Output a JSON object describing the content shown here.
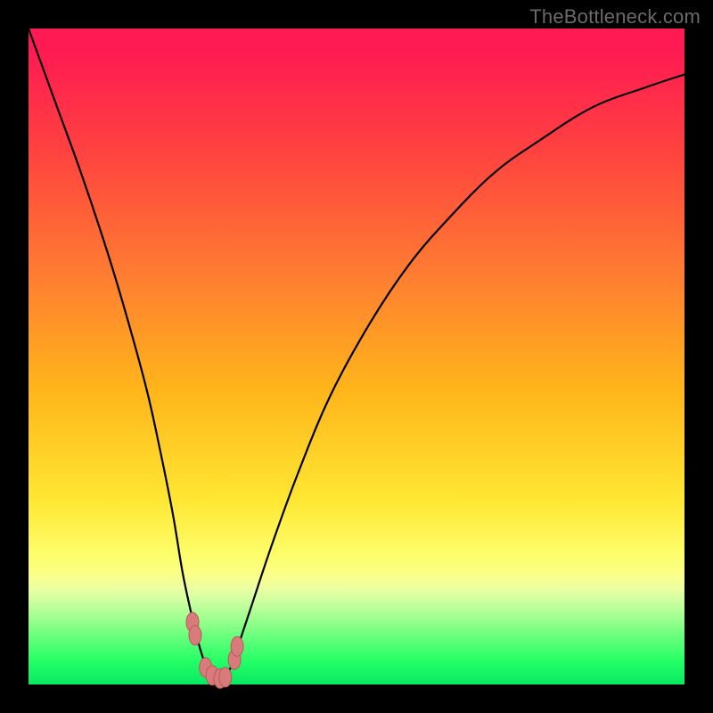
{
  "watermark": "TheBottleneck.com",
  "chart_data": {
    "type": "line",
    "title": "",
    "xlabel": "",
    "ylabel": "",
    "xlim": [
      0,
      100
    ],
    "ylim": [
      0,
      100
    ],
    "series": [
      {
        "name": "bottleneck-curve",
        "x": [
          0,
          4,
          8,
          12,
          15,
          18,
          20,
          22,
          23.5,
          25,
          26,
          27,
          28,
          29,
          30,
          31,
          32,
          34,
          37,
          41,
          46,
          52,
          58,
          64,
          71,
          78,
          86,
          94,
          100
        ],
        "values": [
          100,
          89,
          78,
          66,
          56,
          45,
          36,
          26,
          17,
          10,
          6,
          3,
          1.5,
          0.7,
          1.2,
          3,
          6,
          12,
          21,
          32,
          44,
          55,
          64,
          71,
          78,
          83,
          88,
          91,
          93
        ]
      }
    ],
    "markers": [
      {
        "x": 25.0,
        "y": 9.5
      },
      {
        "x": 25.4,
        "y": 7.5
      },
      {
        "x": 27.0,
        "y": 2.6
      },
      {
        "x": 28.0,
        "y": 1.4
      },
      {
        "x": 29.2,
        "y": 0.9
      },
      {
        "x": 30.0,
        "y": 1.1
      },
      {
        "x": 31.4,
        "y": 3.8
      },
      {
        "x": 31.8,
        "y": 5.8
      }
    ],
    "colors": {
      "curve": "#000000",
      "marker_fill": "#d97b7b",
      "marker_stroke": "#b85a5a"
    }
  }
}
